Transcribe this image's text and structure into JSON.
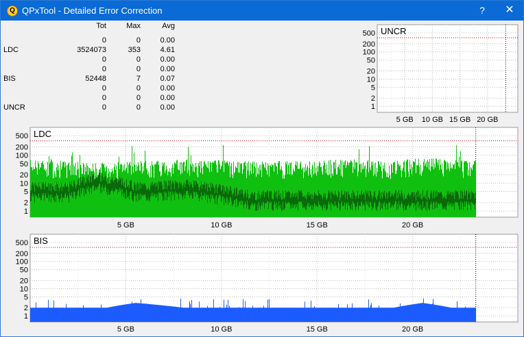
{
  "window": {
    "title": "QPxTool - Detailed Error Correction",
    "help_label": "?",
    "close_label": "✕",
    "app_icon": "Q"
  },
  "stats": {
    "headers": [
      "Tot",
      "Max",
      "Avg"
    ],
    "rows": [
      {
        "label": "",
        "tot": "0",
        "max": "0",
        "avg": "0.00"
      },
      {
        "label": "LDC",
        "tot": "3524073",
        "max": "353",
        "avg": "4.61"
      },
      {
        "label": "",
        "tot": "0",
        "max": "0",
        "avg": "0.00"
      },
      {
        "label": "",
        "tot": "0",
        "max": "0",
        "avg": "0.00"
      },
      {
        "label": "BIS",
        "tot": "52448",
        "max": "7",
        "avg": "0.07"
      },
      {
        "label": "",
        "tot": "0",
        "max": "0",
        "avg": "0.00"
      },
      {
        "label": "",
        "tot": "0",
        "max": "0",
        "avg": "0.00"
      },
      {
        "label": "UNCR",
        "tot": "0",
        "max": "0",
        "avg": "0.00"
      }
    ]
  },
  "colors": {
    "title_bar": "#0a6ad6",
    "ldc_light": "#10c010",
    "ldc_dark": "#0a6a0a",
    "bis": "#1c5cff",
    "threshold": "#c00000"
  },
  "chart_data": [
    {
      "type": "bar",
      "title": "UNCR",
      "y_scale": "log",
      "y_ticks": [
        "500",
        "200",
        "100",
        "50",
        "20",
        "10",
        "5",
        "2",
        "1"
      ],
      "x_ticks": [
        "5 GB",
        "10 GB",
        "15 GB",
        "20 GB"
      ],
      "xlim": [
        0,
        25.5
      ],
      "end_marker": 23.3,
      "values": []
    },
    {
      "type": "bar",
      "title": "LDC",
      "y_scale": "log",
      "y_ticks": [
        "500",
        "200",
        "100",
        "50",
        "20",
        "10",
        "5",
        "2",
        "1"
      ],
      "x_ticks": [
        "5 GB",
        "10 GB",
        "15 GB",
        "20 GB"
      ],
      "xlim": [
        0,
        25.5
      ],
      "end_marker": 23.3,
      "series": [
        {
          "name": "",
          "x": [
            0.0,
            2.0,
            3.5,
            5.5,
            8.0,
            11.5,
            14.0,
            17.0,
            19.0,
            20.5,
            22.0,
            23.3
          ],
          "values": [
            40,
            35,
            30,
            35,
            40,
            35,
            35,
            40,
            35,
            45,
            40,
            35
          ]
        },
        {
          "name": "",
          "x": [
            0.0,
            2.0,
            3.5,
            5.5,
            8.0,
            11.5,
            14.0,
            17.0,
            19.0,
            20.5,
            22.0,
            23.3
          ],
          "values": [
            8,
            8,
            18,
            8,
            10,
            4,
            4,
            4,
            4,
            4,
            4,
            4
          ]
        }
      ]
    },
    {
      "type": "bar",
      "title": "BIS",
      "y_scale": "log",
      "y_ticks": [
        "500",
        "200",
        "100",
        "50",
        "20",
        "10",
        "5",
        "2",
        "1"
      ],
      "x_ticks": [
        "5 GB",
        "10 GB",
        "15 GB",
        "20 GB"
      ],
      "xlim": [
        0,
        25.5
      ],
      "end_marker": 23.3,
      "series": [
        {
          "name": "",
          "x": [
            0.0,
            2.0,
            4.0,
            5.5,
            8.0,
            11.0,
            14.0,
            17.0,
            19.0,
            20.5,
            22.0,
            23.3
          ],
          "values": [
            2,
            2,
            2,
            3,
            2,
            2,
            2,
            2,
            2,
            3,
            2,
            2
          ]
        }
      ]
    }
  ]
}
